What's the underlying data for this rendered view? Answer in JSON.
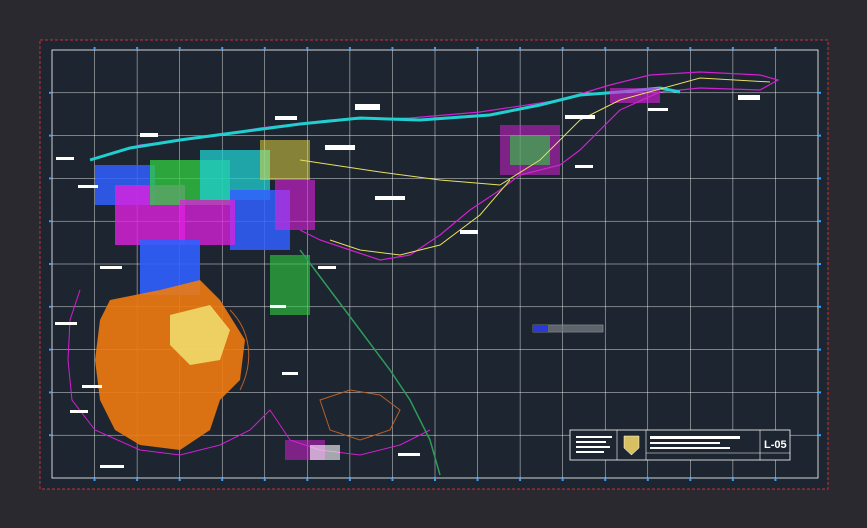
{
  "drawing": {
    "background_color": "#2b2930",
    "sheet_color": "#1c2530",
    "sheet_border_color": "#c83232",
    "grid_color": "#ffffff",
    "grid_columns": 18,
    "grid_rows": 10,
    "tick_color": "#3aa0ff"
  },
  "scale_bar": {
    "fill_color": "#2a3ad8",
    "outline_color": "#aaaaaa"
  },
  "title_block": {
    "logo_text": "L-05",
    "border_color": "#ffffff"
  },
  "map": {
    "layer_colors": {
      "urban_orange": "#f07a10",
      "urban_blue": "#3060ff",
      "urban_magenta": "#e020e0",
      "urban_green": "#30d040",
      "urban_cyan": "#20d0d0",
      "urban_yellow": "#f0e040",
      "road_yellow": "#e8e060",
      "boundary_magenta": "#d020d0",
      "contour_brown": "#b8602a",
      "river_green": "#2f9a5a"
    }
  }
}
